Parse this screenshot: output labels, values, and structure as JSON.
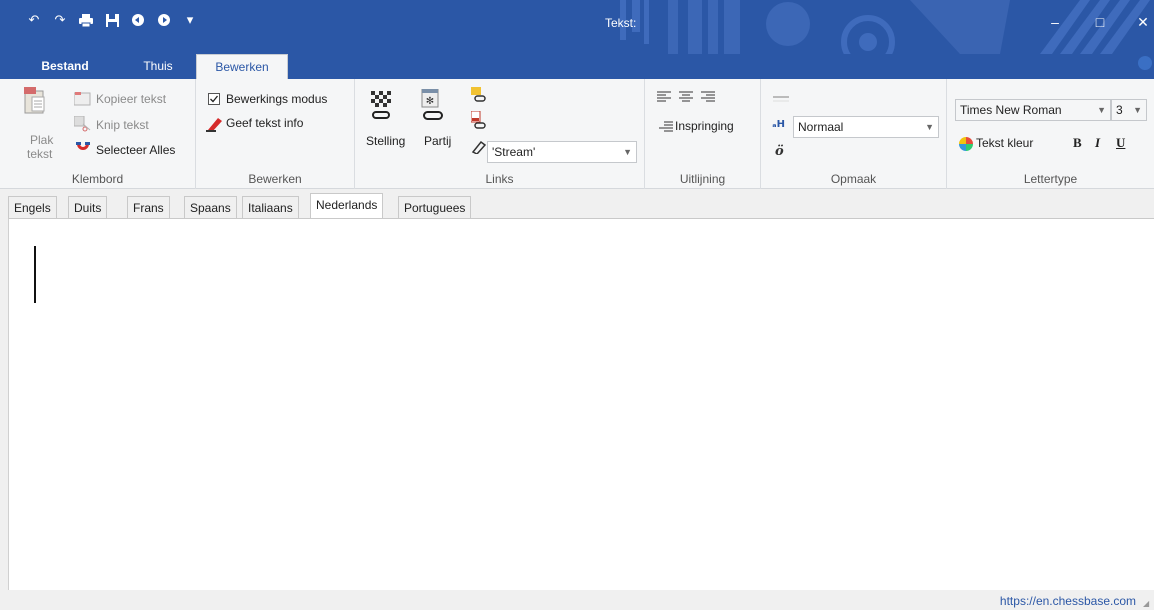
{
  "window": {
    "title": "Tekst:",
    "controls": {
      "minimize": "‒",
      "maximize": "□",
      "close": "✕"
    }
  },
  "quick_access": [
    {
      "icon": "undo-icon",
      "glyph": "↶"
    },
    {
      "icon": "redo-icon",
      "glyph": "↷"
    },
    {
      "icon": "print-icon",
      "glyph": "🖶"
    },
    {
      "icon": "save-icon",
      "glyph": "▪"
    },
    {
      "icon": "back-icon",
      "glyph": "◐"
    },
    {
      "icon": "forward-icon",
      "glyph": "◑"
    },
    {
      "icon": "customize-dropdown-icon",
      "glyph": "▾"
    }
  ],
  "ribbon_tabs": {
    "file": "Bestand",
    "home": "Thuis",
    "edit": "Bewerken"
  },
  "groups": {
    "clipboard": {
      "label": "Klembord",
      "paste": "Plak tekst",
      "paste_line1": "Plak",
      "paste_line2": "tekst",
      "copy": "Kopieer tekst",
      "cut": "Knip tekst",
      "select_all": "Selecteer Alles"
    },
    "edit": {
      "label": "Bewerken",
      "edit_mode": "Bewerkings modus",
      "text_info": "Geef tekst info"
    },
    "links": {
      "label": "Links",
      "position": "Stelling",
      "game": "Partij",
      "stream_value": "'Stream'"
    },
    "alignment": {
      "label": "Uitlijning",
      "indent": "Inspringing"
    },
    "format": {
      "label": "Opmaak",
      "style_value": "Normaal"
    },
    "font": {
      "label": "Lettertype",
      "font_name": "Times New Roman",
      "font_size": "3",
      "text_color": "Tekst kleur",
      "bold": "B",
      "italic": "I",
      "underline": "U"
    }
  },
  "doc_tabs": [
    "Engels",
    "Duits",
    "Frans",
    "Spaans",
    "Italiaans",
    "Nederlands",
    "Portuguees"
  ],
  "active_doc_tab": "Nederlands",
  "status": {
    "link": "https://en.chessbase.com"
  },
  "colors": {
    "accent": "#2b57a6",
    "ribbon_bg": "#f5f6f7"
  }
}
